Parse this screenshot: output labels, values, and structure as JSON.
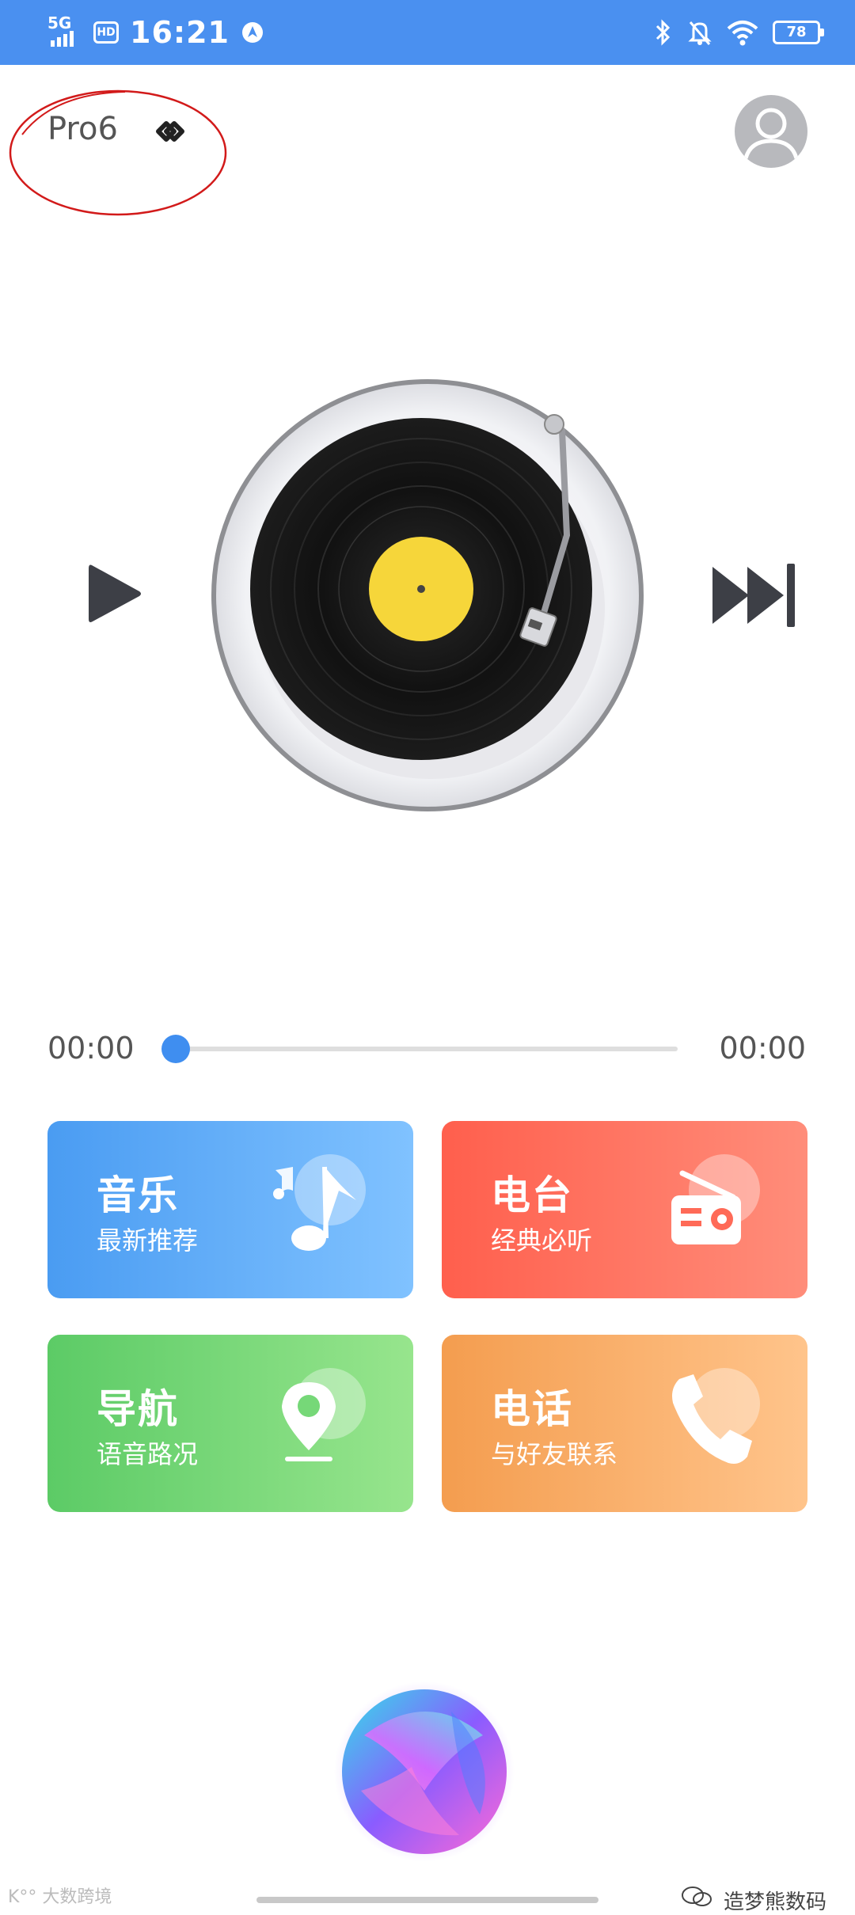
{
  "status_bar": {
    "network": "5G",
    "hd": "HD",
    "time": "16:21",
    "battery": "78",
    "icons": [
      "signal-icon",
      "hd-icon",
      "location-icon",
      "bluetooth-icon",
      "mute-icon",
      "wifi-icon",
      "battery-icon"
    ],
    "background": "#4a90f0"
  },
  "header": {
    "device_name": "Pro6",
    "device_icon": "link-icon",
    "avatar_icon": "user-avatar-icon"
  },
  "player": {
    "play_icon": "play-icon",
    "next_icon": "next-track-icon",
    "elapsed": "00:00",
    "duration": "00:00",
    "progress": 0
  },
  "cards": [
    {
      "title": "音乐",
      "subtitle": "最新推荐",
      "icon": "music-note-icon"
    },
    {
      "title": "电台",
      "subtitle": "经典必听",
      "icon": "radio-icon"
    },
    {
      "title": "导航",
      "subtitle": "语音路况",
      "icon": "location-pin-icon"
    },
    {
      "title": "电话",
      "subtitle": "与好友联系",
      "icon": "phone-icon"
    }
  ],
  "watermarks": {
    "right": "造梦熊数码",
    "left": "K°° 大数跨境"
  },
  "colors": {
    "accent": "#3f8ef0",
    "music": "#4a9cf2",
    "radio": "#ff5f4d",
    "nav": "#5ccb66",
    "phone": "#f49d4f",
    "annotation": "#d21a1a"
  }
}
